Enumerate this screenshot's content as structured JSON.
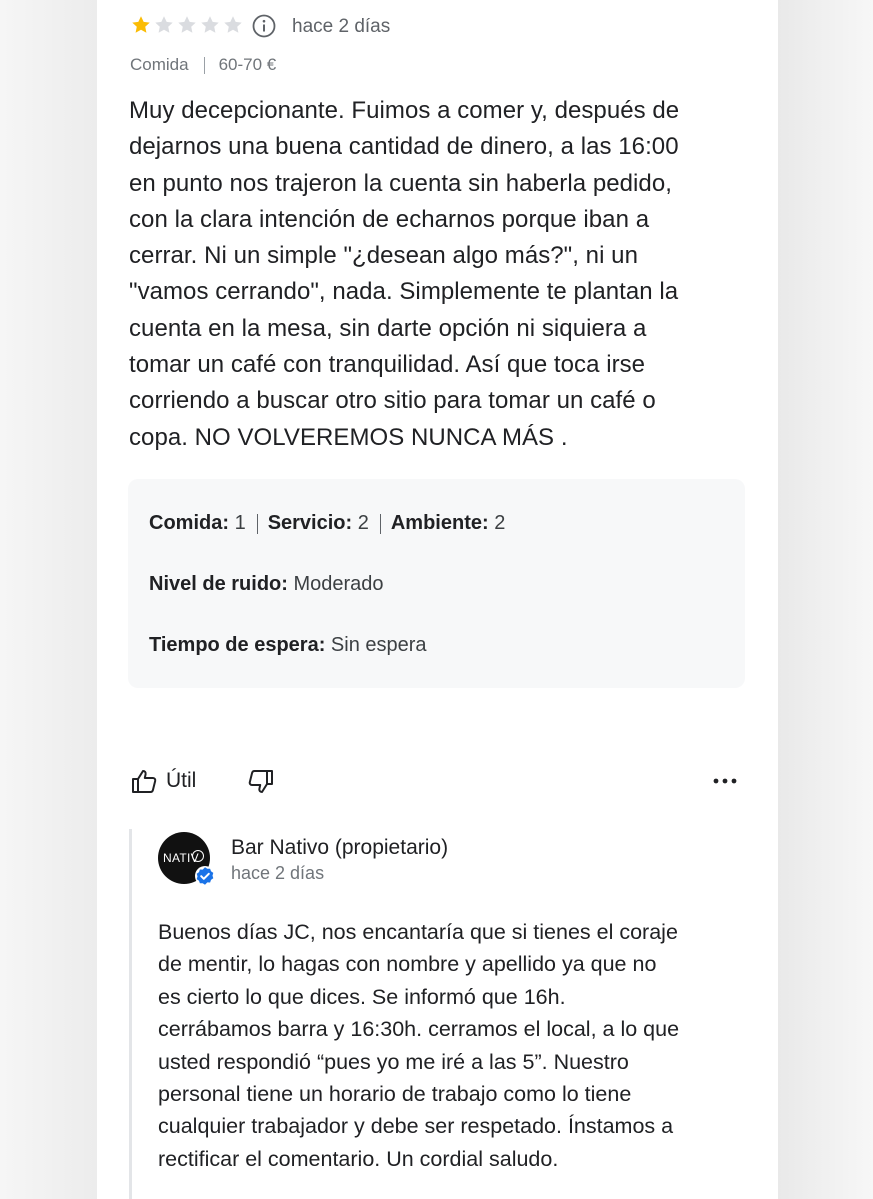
{
  "review": {
    "rating": 1,
    "max_rating": 5,
    "time": "hace 2 días",
    "category": "Comida",
    "price": "60-70 €",
    "lines": [
      "Muy decepcionante. Fuimos a comer y, después de",
      "dejarnos una buena cantidad de dinero, a las 16:00",
      "en punto nos trajeron la cuenta sin haberla pedido,",
      "con la clara intención de echarnos porque iban a",
      "cerrar. Ni un simple \"¿desean algo más?\", ni un",
      "\"vamos cerrando\", nada. Simplemente te plantan la",
      "cuenta en la mesa, sin darte opción ni siquiera a",
      "tomar un café con tranquilidad. Así que toca irse",
      "corriendo a buscar otro sitio para tomar un café o",
      "copa. NO VOLVEREMOS NUNCA MÁS ."
    ]
  },
  "ratings": {
    "food_label": "Comida:",
    "food_value": "1",
    "service_label": "Servicio:",
    "service_value": "2",
    "ambience_label": "Ambiente:",
    "ambience_value": "2",
    "noise_label": "Nivel de ruido:",
    "noise_value": "Moderado",
    "wait_label": "Tiempo de espera:",
    "wait_value": "Sin espera"
  },
  "actions": {
    "useful_label": "Útil"
  },
  "owner_reply": {
    "avatar_text": "NATIV",
    "name": "Bar Nativo (propietario)",
    "time": "hace 2 días",
    "lines": [
      "Buenos días JC,  nos encantaría que si tienes el coraje",
      "de mentir,  lo hagas con nombre y apellido ya que no",
      "es cierto lo que dices.  Se informó que 16h.",
      "cerrábamos barra y 16:30h. cerramos el local, a lo que",
      "usted respondió “pues yo me iré a las 5”. Nuestro",
      "personal tiene un horario de trabajo como lo tiene",
      "cualquier trabajador y debe ser respetado. Ínstamos a",
      "rectificar el comentario. Un cordial saludo."
    ]
  },
  "colors": {
    "star_filled": "#fbbc04",
    "star_empty": "#dadce0",
    "verified": "#1a73e8"
  }
}
